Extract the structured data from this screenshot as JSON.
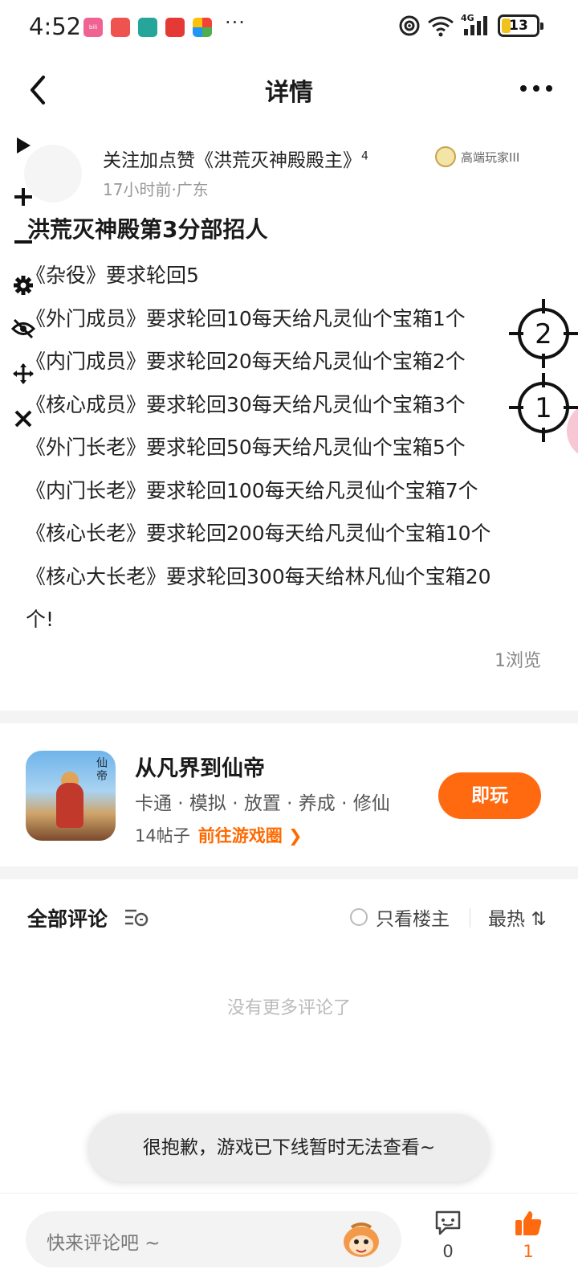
{
  "status_bar": {
    "time": "4:52",
    "app_icons": [
      {
        "name": "bilibili",
        "color": "#f06292",
        "text": "bili"
      },
      {
        "name": "shop",
        "color": "#ef5350",
        "text": ""
      },
      {
        "name": "tool-app",
        "color": "#26a69a",
        "text": ""
      },
      {
        "name": "app-red",
        "color": "#e53935",
        "text": ""
      },
      {
        "name": "pinwheel",
        "color": "#ffffff",
        "text": ""
      }
    ],
    "more": "···",
    "network": "4G",
    "battery": "13"
  },
  "nav": {
    "title": "详情"
  },
  "post": {
    "author": "关注加点赞《洪荒灭神殿殿主》",
    "author_sup": "4",
    "badge_label": "高端玩家III",
    "meta": "17小时前·广东",
    "title": "洪荒灭神殿第3分部招人",
    "lines": [
      "《杂役》要求轮回5",
      "《外门成员》要求轮回10每天给凡灵仙个宝箱1个",
      "《内门成员》要求轮回20每天给凡灵仙个宝箱2个",
      "《核心成员》要求轮回30每天给凡灵仙个宝箱3个",
      "《外门长老》要求轮回50每天给凡灵仙个宝箱5个",
      "《内门长老》要求轮回100每天给凡灵仙个宝箱7个",
      "《核心长老》要求轮回200每天给凡灵仙个宝箱10个",
      "《核心大长老》要求轮回300每天给林凡仙个宝箱20",
      "个!"
    ],
    "views": "1浏览"
  },
  "targets": {
    "first": "1",
    "second": "2"
  },
  "game": {
    "name": "从凡界到仙帝",
    "tags": "卡通 · 模拟 · 放置 · 养成 · 修仙",
    "posts": "14帖子",
    "link": "前往游戏圈 ❯",
    "play": "即玩",
    "icon_calligraphy": "仙帝"
  },
  "comments": {
    "title": "全部评论",
    "only_host": "只看楼主",
    "sort": "最热 ⇅",
    "empty": "没有更多评论了"
  },
  "toast": "很抱歉，游戏已下线暂时无法查看~",
  "bottom": {
    "placeholder": "快来评论吧 ~",
    "comment_count": "0",
    "like_count": "1"
  },
  "colors": {
    "accent": "#ff6a10"
  }
}
